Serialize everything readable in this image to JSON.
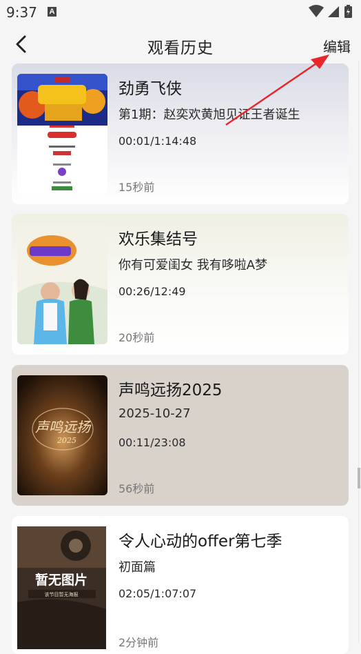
{
  "status_bar": {
    "time": "9:37",
    "a_icon": "A"
  },
  "header": {
    "back_icon": "chevron-left-icon",
    "title": "观看历史",
    "edit_label": "编辑"
  },
  "history": [
    {
      "title": "劲勇飞侠",
      "subtitle": "第1期：赵奕欢黄旭见证王者诞生",
      "progress": "00:01/1:14:48",
      "time_ago": "15秒前"
    },
    {
      "title": "欢乐集结号",
      "subtitle": "你有可爱闺女 我有哆啦A梦",
      "progress": "00:26/12:49",
      "time_ago": "20秒前"
    },
    {
      "title": "声鸣远扬2025",
      "subtitle": "2025-10-27",
      "progress": "00:11/23:08",
      "time_ago": "56秒前"
    },
    {
      "title": "令人心动的offer第七季",
      "subtitle": "初面篇",
      "progress": "02:05/1:07:07",
      "time_ago": "2分钟前"
    }
  ],
  "posters": {
    "p3_logo": "声鸣远扬",
    "p3_year": "2025",
    "p4_title": "暂无图片",
    "p4_caption": "该节目暂无海报"
  },
  "colors": {
    "annotation_arrow": "#e8262b",
    "card3_bg": "#d9d2cb"
  }
}
